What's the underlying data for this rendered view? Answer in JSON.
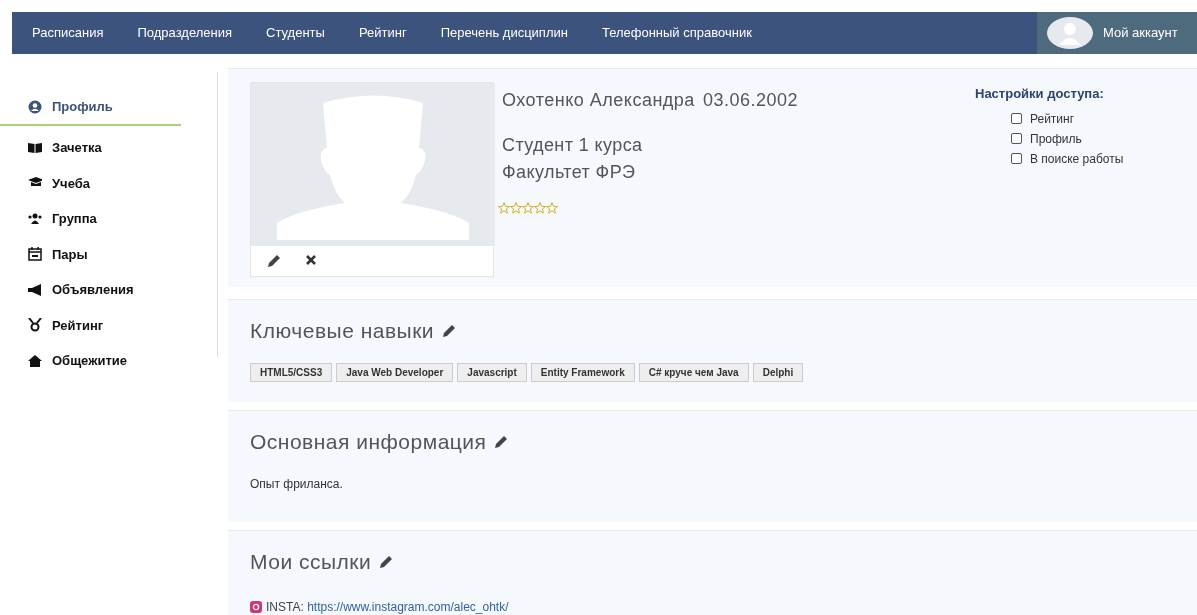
{
  "nav": {
    "items": [
      {
        "label": "Расписания"
      },
      {
        "label": "Подразделения"
      },
      {
        "label": "Студенты"
      },
      {
        "label": "Рейтинг"
      },
      {
        "label": "Перечень дисциплин"
      },
      {
        "label": "Телефонный справочник"
      }
    ],
    "account": "Мой аккаунт"
  },
  "sidebar": {
    "items": [
      {
        "label": "Профиль",
        "selected": true
      },
      {
        "label": "Зачетка",
        "selected": false
      },
      {
        "label": "Учеба",
        "selected": false
      },
      {
        "label": "Группа",
        "selected": false
      },
      {
        "label": "Пары",
        "selected": false
      },
      {
        "label": "Объявления",
        "selected": false
      },
      {
        "label": "Рейтинг",
        "selected": false
      },
      {
        "label": "Общежитие",
        "selected": false
      }
    ]
  },
  "profile": {
    "name": "Охотенко Александра",
    "birthdate": "03.06.2002",
    "course": "Студент 1 курса",
    "faculty": "Факультет ФРЭ",
    "stars": 0,
    "access": {
      "title": "Настройки доступа:",
      "options": [
        {
          "label": "Рейтинг",
          "checked": false
        },
        {
          "label": "Профиль",
          "checked": false
        },
        {
          "label": "В поиске работы",
          "checked": false
        }
      ]
    }
  },
  "skills": {
    "title": "Ключевые навыки",
    "tags": [
      "HTML5/CSS3",
      "Java Web Developer",
      "Javascript",
      "Entity Framework",
      "C# круче чем Java",
      "Delphi"
    ]
  },
  "info": {
    "title": "Основная информация",
    "text": "Опыт фриланса."
  },
  "links": {
    "title": "Мои ссылки",
    "items": [
      {
        "label": "INSTA:",
        "url": "https://www.instagram.com/alec_ohtk/"
      }
    ]
  }
}
